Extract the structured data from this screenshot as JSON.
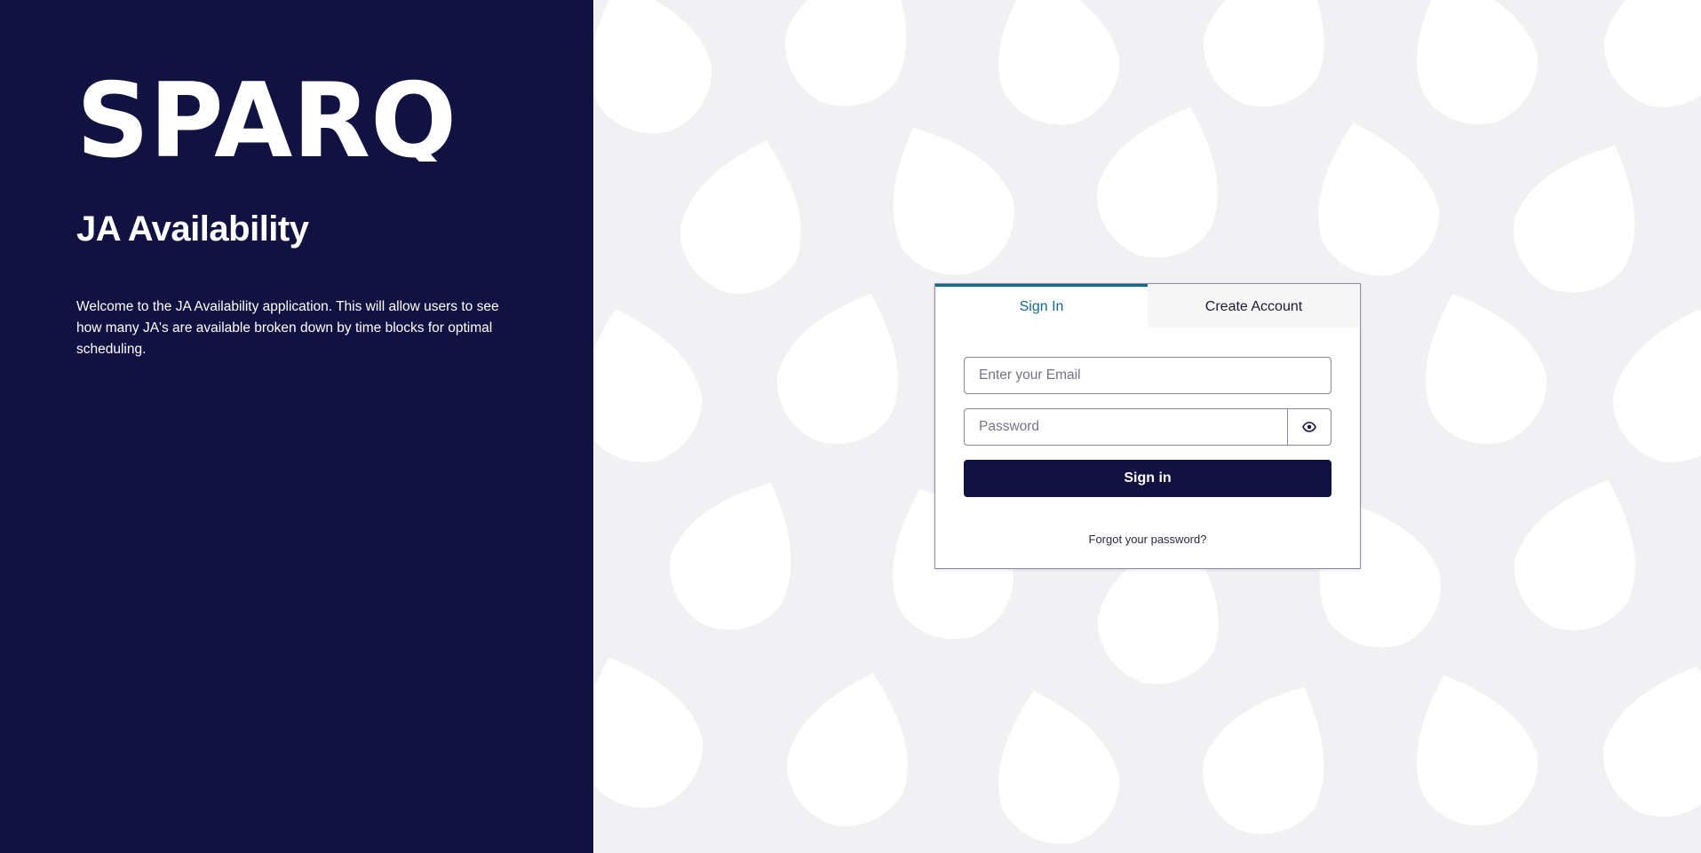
{
  "brand": {
    "logo_text": "SPARQ"
  },
  "left": {
    "title": "JA Availability",
    "welcome": "Welcome to the JA Availability application. This will allow users to see how many JA's are available broken down by time blocks for optimal scheduling."
  },
  "auth": {
    "tabs": [
      {
        "label": "Sign In",
        "active": true
      },
      {
        "label": "Create Account",
        "active": false
      }
    ],
    "email_placeholder": "Enter your Email",
    "password_placeholder": "Password",
    "show_password_icon": "eye-icon",
    "signin_label": "Sign in",
    "forgot_label": "Forgot your password?"
  },
  "colors": {
    "navy": "#111142",
    "accent": "#0e6a8e",
    "background": "#f1f1f4"
  }
}
